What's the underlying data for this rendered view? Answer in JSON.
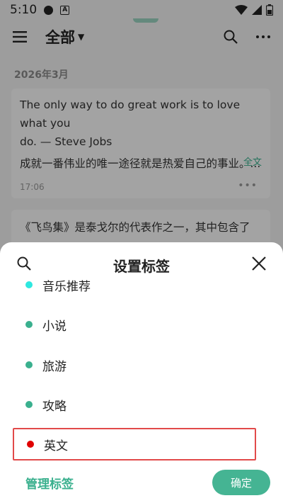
{
  "status_bar": {
    "time": "5:10"
  },
  "app_bar": {
    "title": "全部"
  },
  "feed": {
    "month": "2026年3月",
    "cards": [
      {
        "en_line1": "The only way to do great work is to love what you",
        "en_line2": "do. — Steve Jobs",
        "cn_line": "成就一番伟业的唯一途径就是热爱自己的事业。...",
        "more_label": "全文",
        "time": "17:06"
      },
      {
        "line1": "《飞鸟集》是泰戈尔的代表作之一，其中包含了"
      }
    ]
  },
  "tag_sheet": {
    "title": "设置标签",
    "tags": [
      {
        "label": "音乐推荐",
        "color": "#2ee8e0"
      },
      {
        "label": "小说",
        "color": "#3ab08e"
      },
      {
        "label": "旅游",
        "color": "#3ab08e"
      },
      {
        "label": "攻略",
        "color": "#3ab08e"
      },
      {
        "label": "英文",
        "color": "#e00000"
      }
    ],
    "manage_label": "管理标签",
    "confirm_label": "确定"
  }
}
